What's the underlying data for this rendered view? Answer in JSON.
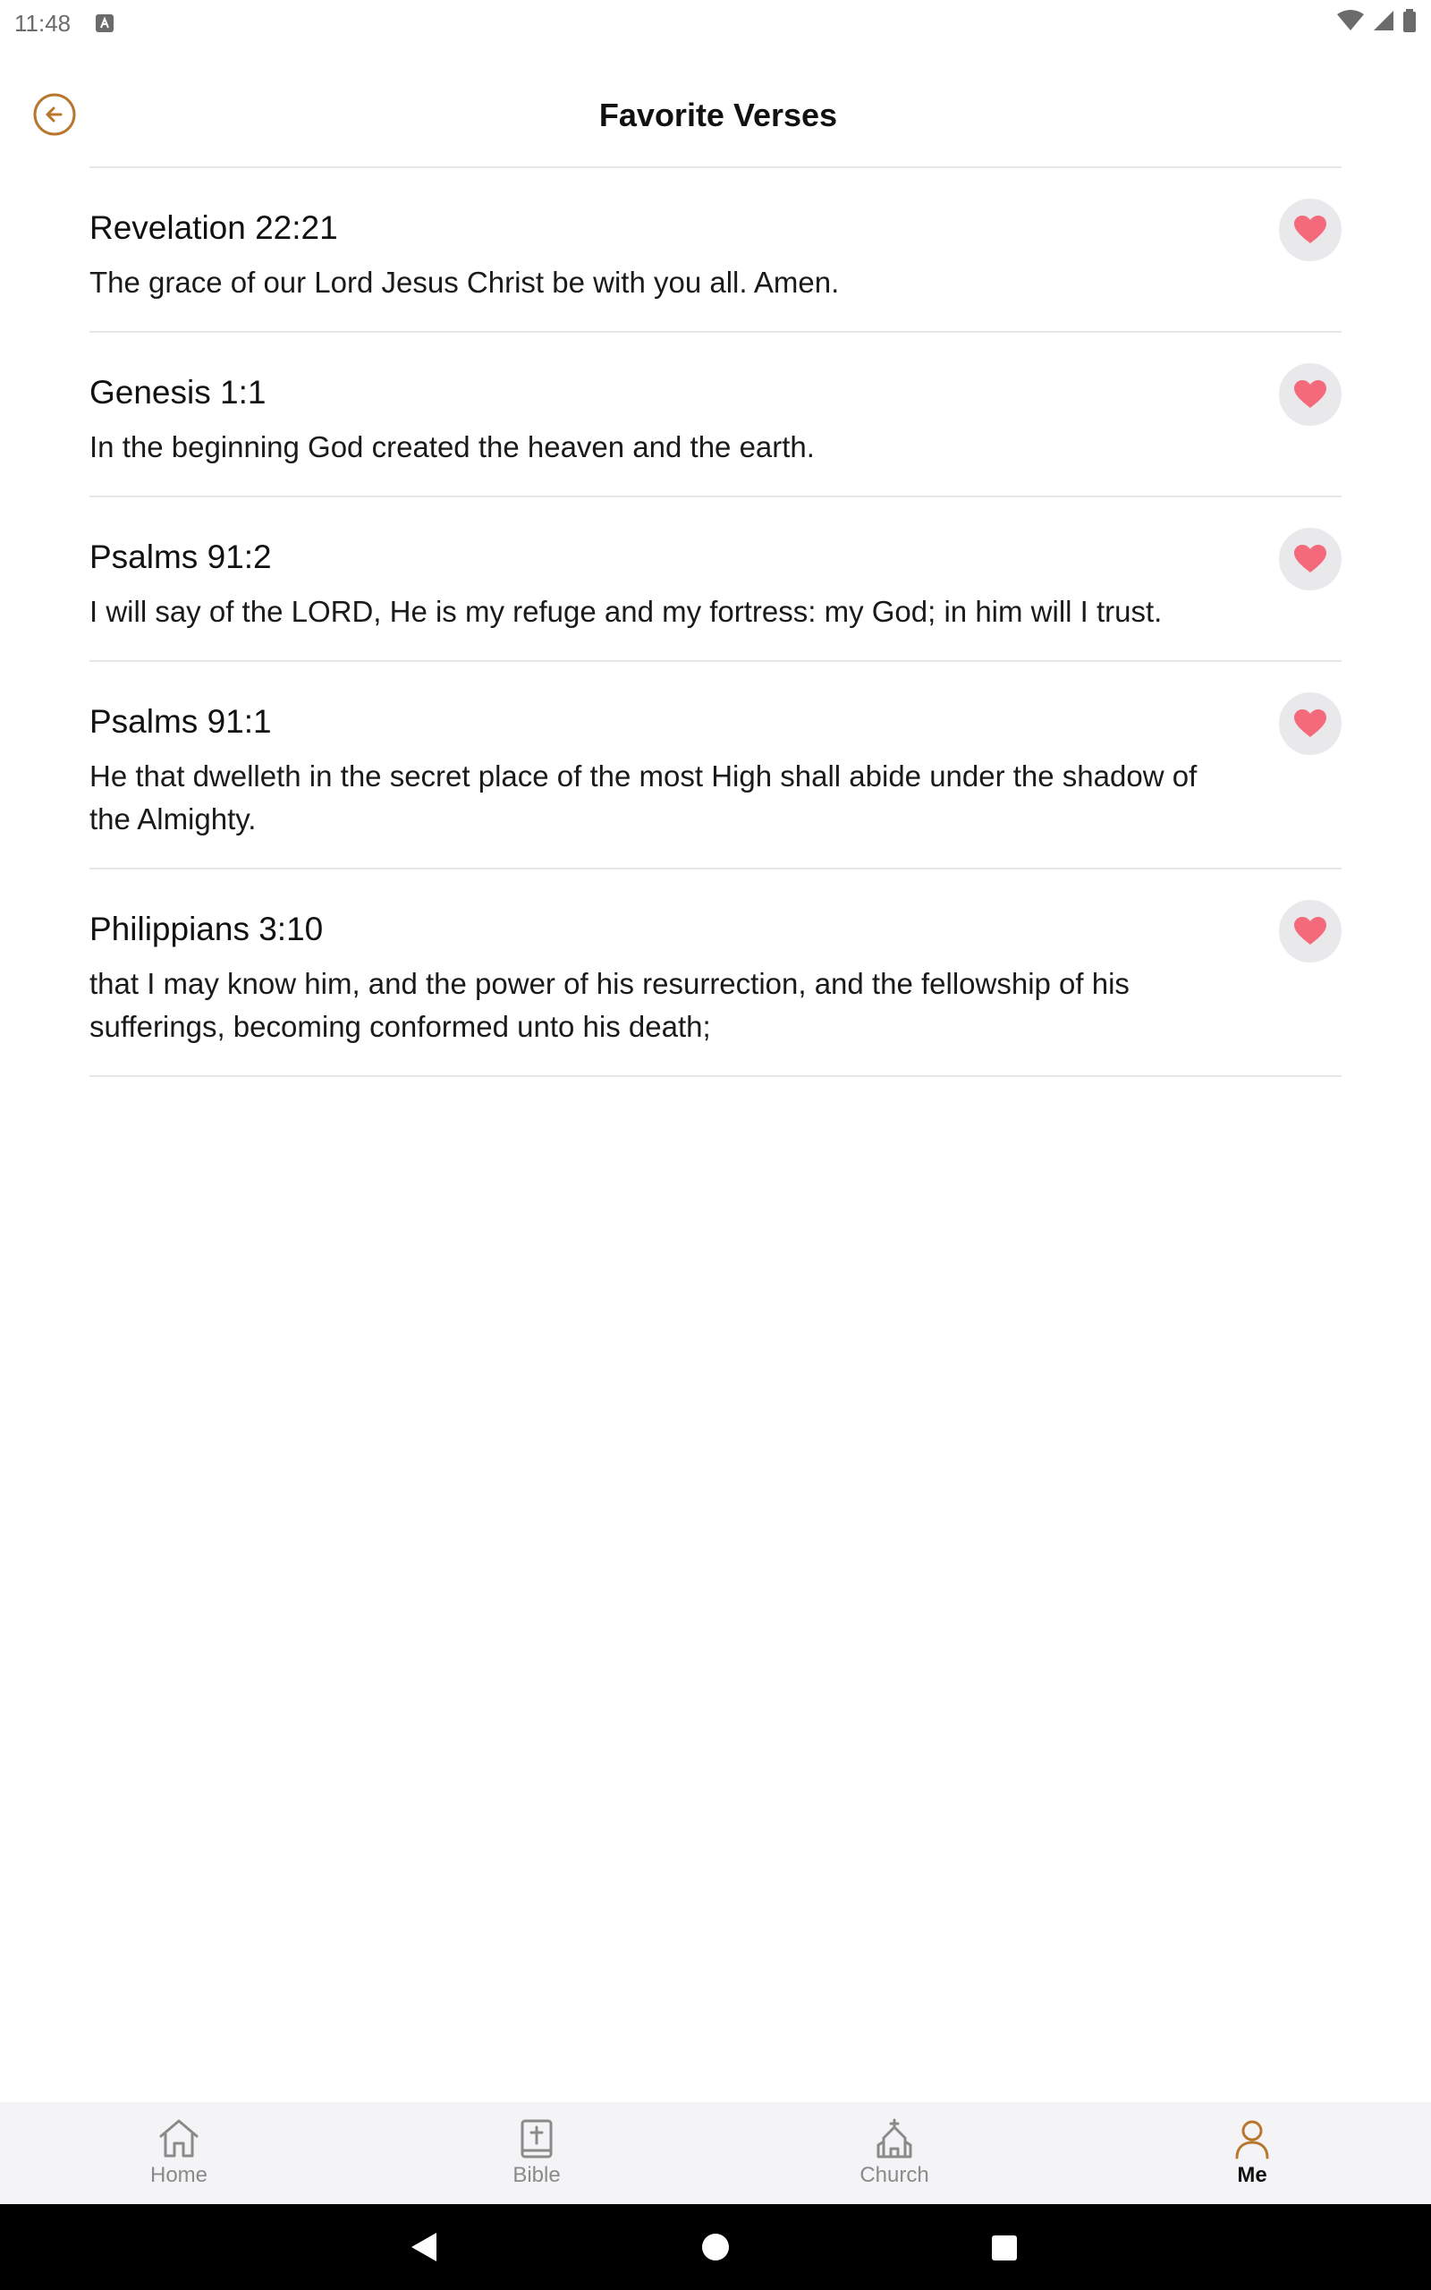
{
  "status_bar": {
    "time": "11:48",
    "icons": [
      "app-notification-icon",
      "wifi-icon",
      "cell-signal-icon",
      "battery-icon"
    ]
  },
  "header": {
    "title": "Favorite Verses",
    "back_icon": "back-arrow-circle-icon"
  },
  "colors": {
    "accent": "#b8762e",
    "heart": "#f46a7a",
    "heart_button_bg": "#e9e9ec",
    "divider": "#e6e6e6",
    "nav_bg": "#f4f4f6"
  },
  "verses": [
    {
      "reference": "Revelation 22:21",
      "text": "The grace of our Lord Jesus Christ be with you all. Amen."
    },
    {
      "reference": "Genesis 1:1",
      "text": "In the beginning God created the heaven and the earth."
    },
    {
      "reference": "Psalms 91:2",
      "text": "I will say of the LORD, He is my refuge and my fortress: my God; in him will I trust."
    },
    {
      "reference": "Psalms 91:1",
      "text": "He that dwelleth in the secret place of the most High shall abide under the shadow of the Almighty."
    },
    {
      "reference": "Philippians 3:10",
      "text": "that I may know him, and the power of his resurrection, and the fellowship of his sufferings, becoming conformed unto his death;"
    }
  ],
  "bottom_nav": {
    "items": [
      {
        "label": "Home",
        "icon": "home-icon",
        "active": false
      },
      {
        "label": "Bible",
        "icon": "bible-icon",
        "active": false
      },
      {
        "label": "Church",
        "icon": "church-icon",
        "active": false
      },
      {
        "label": "Me",
        "icon": "person-icon",
        "active": true
      }
    ]
  },
  "system_nav": {
    "icons": [
      "back-triangle-icon",
      "home-circle-icon",
      "recents-square-icon"
    ]
  }
}
